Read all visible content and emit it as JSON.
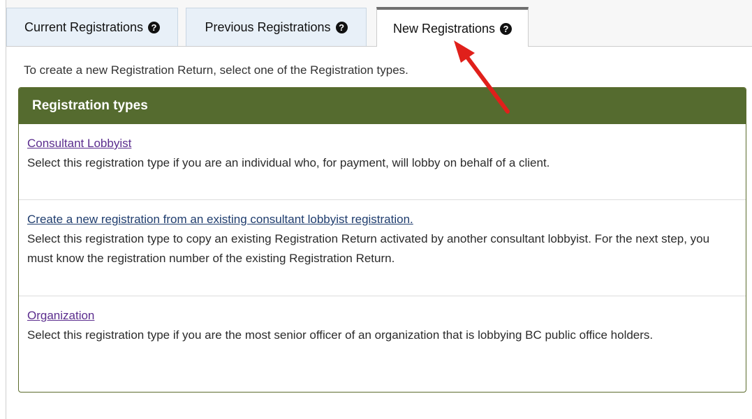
{
  "tabs": [
    {
      "label": "Current Registrations"
    },
    {
      "label": "Previous Registrations"
    },
    {
      "label": "New Registrations"
    }
  ],
  "help_glyph": "?",
  "intro_text": "To create a new Registration Return, select one of the Registration types.",
  "panel": {
    "title": "Registration types",
    "items": [
      {
        "link": "Consultant Lobbyist",
        "description": "Select this registration type if you are an individual who, for payment, will lobby on behalf of a client."
      },
      {
        "link": "Create a new registration from an existing consultant lobbyist registration.",
        "description": "Select this registration type to copy an existing Registration Return activated by another consultant lobbyist. For the next step, you must know the registration number of the existing Registration Return."
      },
      {
        "link": "Organization",
        "description": "Select this registration type if you are the most senior officer of an organization that is lobbying BC public office holders."
      }
    ]
  },
  "colors": {
    "panel_header": "#556b2f",
    "tab_inactive": "#e8f0f8",
    "link_visited": "#5b2d8e",
    "annotation_arrow": "#e0201b"
  },
  "icons": {
    "help": "question-circle-icon",
    "annotation": "red-arrow"
  }
}
